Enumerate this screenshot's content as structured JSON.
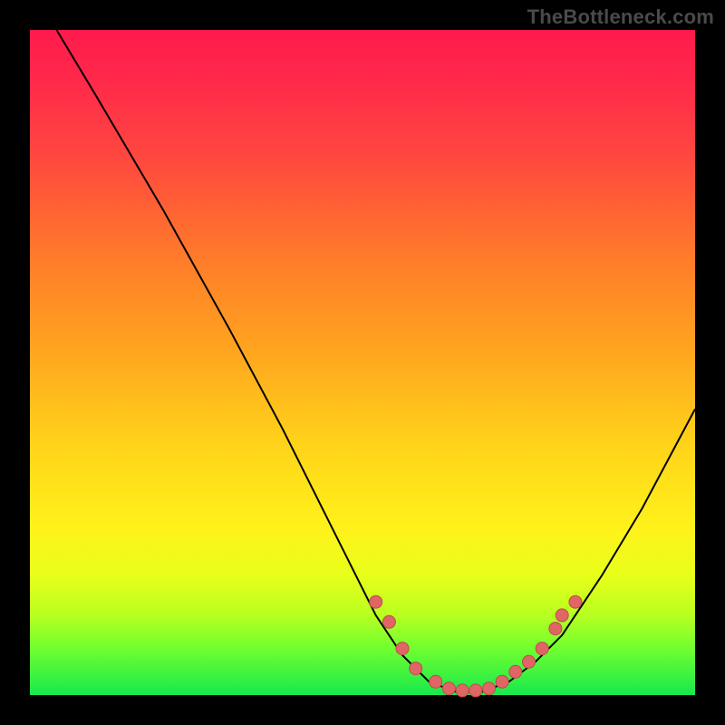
{
  "watermark": "TheBottleneck.com",
  "colors": {
    "background": "#000000",
    "curve_stroke": "#000000",
    "marker_fill": "#e06666",
    "marker_stroke": "#c04a4a"
  },
  "chart_data": {
    "type": "line",
    "title": "",
    "xlabel": "",
    "ylabel": "",
    "xlim": [
      0,
      100
    ],
    "ylim": [
      0,
      100
    ],
    "grid": false,
    "curve": [
      {
        "x": 4,
        "y": 100
      },
      {
        "x": 10,
        "y": 90
      },
      {
        "x": 20,
        "y": 73
      },
      {
        "x": 30,
        "y": 55
      },
      {
        "x": 38,
        "y": 40
      },
      {
        "x": 46,
        "y": 24
      },
      {
        "x": 52,
        "y": 12
      },
      {
        "x": 56,
        "y": 6
      },
      {
        "x": 60,
        "y": 2
      },
      {
        "x": 64,
        "y": 0.5
      },
      {
        "x": 68,
        "y": 0.5
      },
      {
        "x": 72,
        "y": 2
      },
      {
        "x": 76,
        "y": 5
      },
      {
        "x": 80,
        "y": 9
      },
      {
        "x": 86,
        "y": 18
      },
      {
        "x": 92,
        "y": 28
      },
      {
        "x": 100,
        "y": 43
      }
    ],
    "series": [
      {
        "name": "markers",
        "points": [
          {
            "x": 52,
            "y": 14
          },
          {
            "x": 54,
            "y": 11
          },
          {
            "x": 56,
            "y": 7
          },
          {
            "x": 58,
            "y": 4
          },
          {
            "x": 61,
            "y": 2
          },
          {
            "x": 63,
            "y": 1
          },
          {
            "x": 65,
            "y": 0.7
          },
          {
            "x": 67,
            "y": 0.7
          },
          {
            "x": 69,
            "y": 1
          },
          {
            "x": 71,
            "y": 2
          },
          {
            "x": 73,
            "y": 3.5
          },
          {
            "x": 75,
            "y": 5
          },
          {
            "x": 77,
            "y": 7
          },
          {
            "x": 79,
            "y": 10
          },
          {
            "x": 80,
            "y": 12
          },
          {
            "x": 82,
            "y": 14
          }
        ]
      }
    ]
  }
}
